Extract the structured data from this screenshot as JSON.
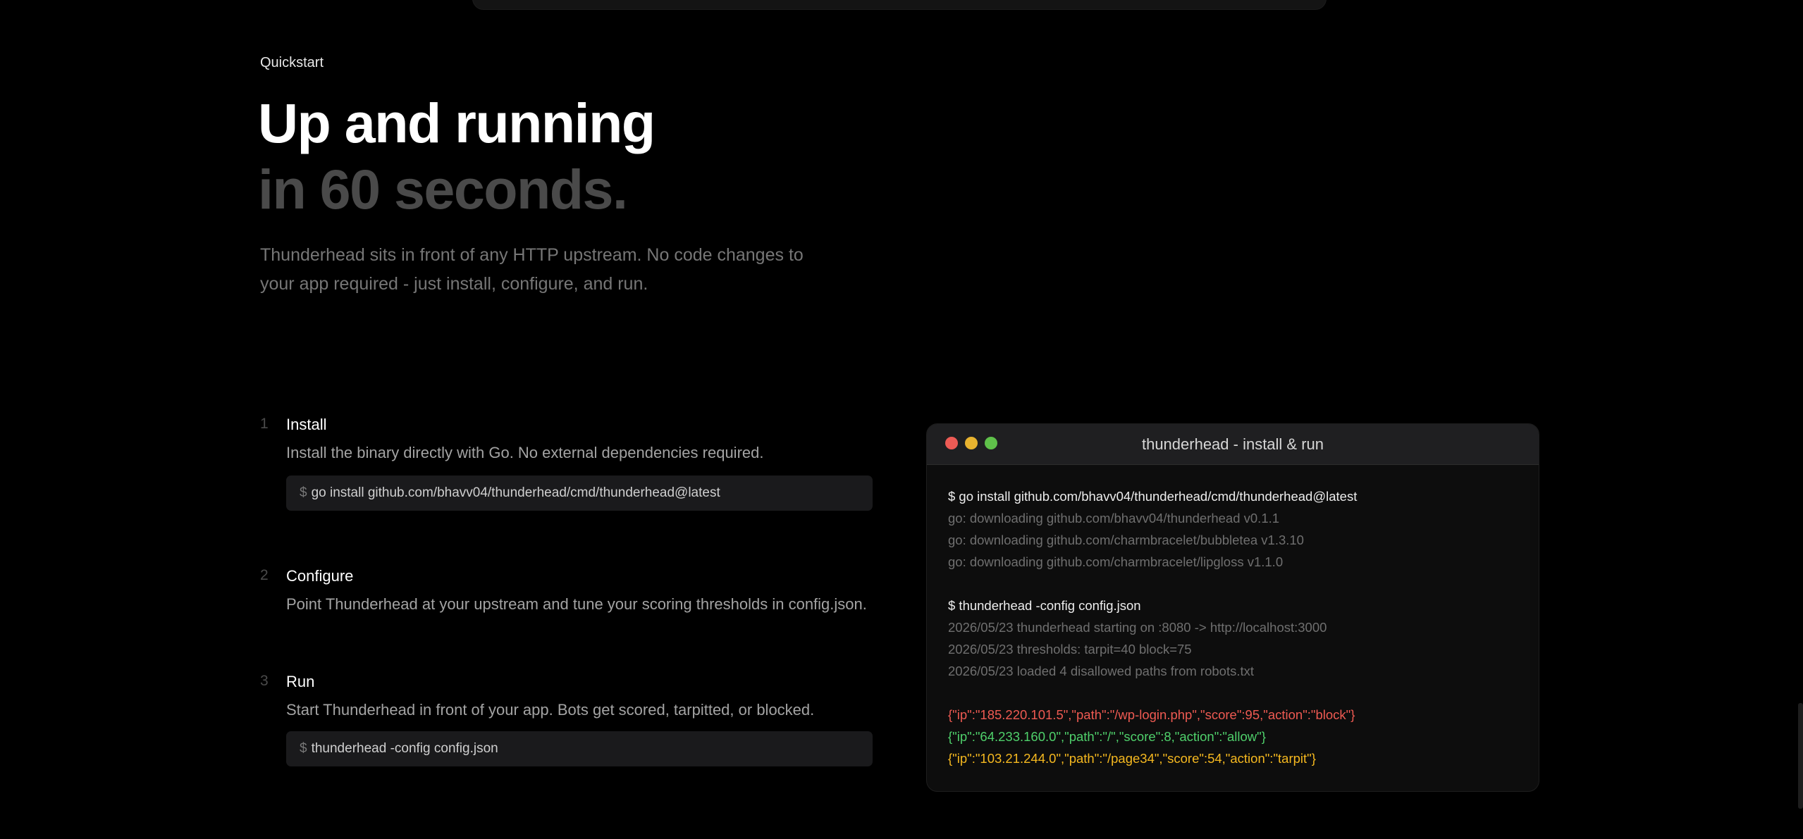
{
  "hero": {
    "eyebrow": "Quickstart",
    "title_line1": "Up and running",
    "title_line2": "in 60 seconds.",
    "description": "Thunderhead sits in front of any HTTP upstream. No code changes to your app required - just install, configure, and run."
  },
  "steps": [
    {
      "number": "1",
      "title": "Install",
      "description": "Install the binary directly with Go. No external dependencies required.",
      "command_prompt": "$",
      "command": "go install github.com/bhavv04/thunderhead/cmd/thunderhead@latest"
    },
    {
      "number": "2",
      "title": "Configure",
      "description": "Point Thunderhead at your upstream and tune your scoring thresholds in config.json."
    },
    {
      "number": "3",
      "title": "Run",
      "description": "Start Thunderhead in front of your app. Bots get scored, tarpitted, or blocked.",
      "command_prompt": "$",
      "command": "thunderhead -config config.json"
    }
  ],
  "terminal": {
    "title": "thunderhead - install & run",
    "window_controls": [
      "close-dot",
      "minimize-dot",
      "maximize-dot"
    ],
    "colors": {
      "close": "#ed5b55",
      "minimize": "#e8b32f",
      "maximize": "#5fc14a",
      "block": "#ee5a52",
      "allow": "#4fd06b",
      "tarpit": "#f5b81f"
    },
    "lines": [
      {
        "kind": "cmd",
        "text": "$ go install github.com/bhavv04/thunderhead/cmd/thunderhead@latest"
      },
      {
        "kind": "out",
        "text": "go: downloading github.com/bhavv04/thunderhead v0.1.1"
      },
      {
        "kind": "out",
        "text": "go: downloading github.com/charmbracelet/bubbletea v1.3.10"
      },
      {
        "kind": "out",
        "text": "go: downloading github.com/charmbracelet/lipgloss v1.1.0"
      },
      {
        "kind": "gap",
        "text": ""
      },
      {
        "kind": "cmd",
        "text": "$ thunderhead -config config.json"
      },
      {
        "kind": "out",
        "text": "2026/05/23 thunderhead starting on :8080 -> http://localhost:3000"
      },
      {
        "kind": "out",
        "text": "2026/05/23 thresholds: tarpit=40 block=75"
      },
      {
        "kind": "out",
        "text": "2026/05/23 loaded 4 disallowed paths from robots.txt"
      },
      {
        "kind": "gap",
        "text": ""
      },
      {
        "kind": "block",
        "text": "{\"ip\":\"185.220.101.5\",\"path\":\"/wp-login.php\",\"score\":95,\"action\":\"block\"}"
      },
      {
        "kind": "allow",
        "text": "{\"ip\":\"64.233.160.0\",\"path\":\"/\",\"score\":8,\"action\":\"allow\"}"
      },
      {
        "kind": "tarpit",
        "text": "{\"ip\":\"103.21.244.0\",\"path\":\"/page34\",\"score\":54,\"action\":\"tarpit\"}"
      }
    ]
  }
}
